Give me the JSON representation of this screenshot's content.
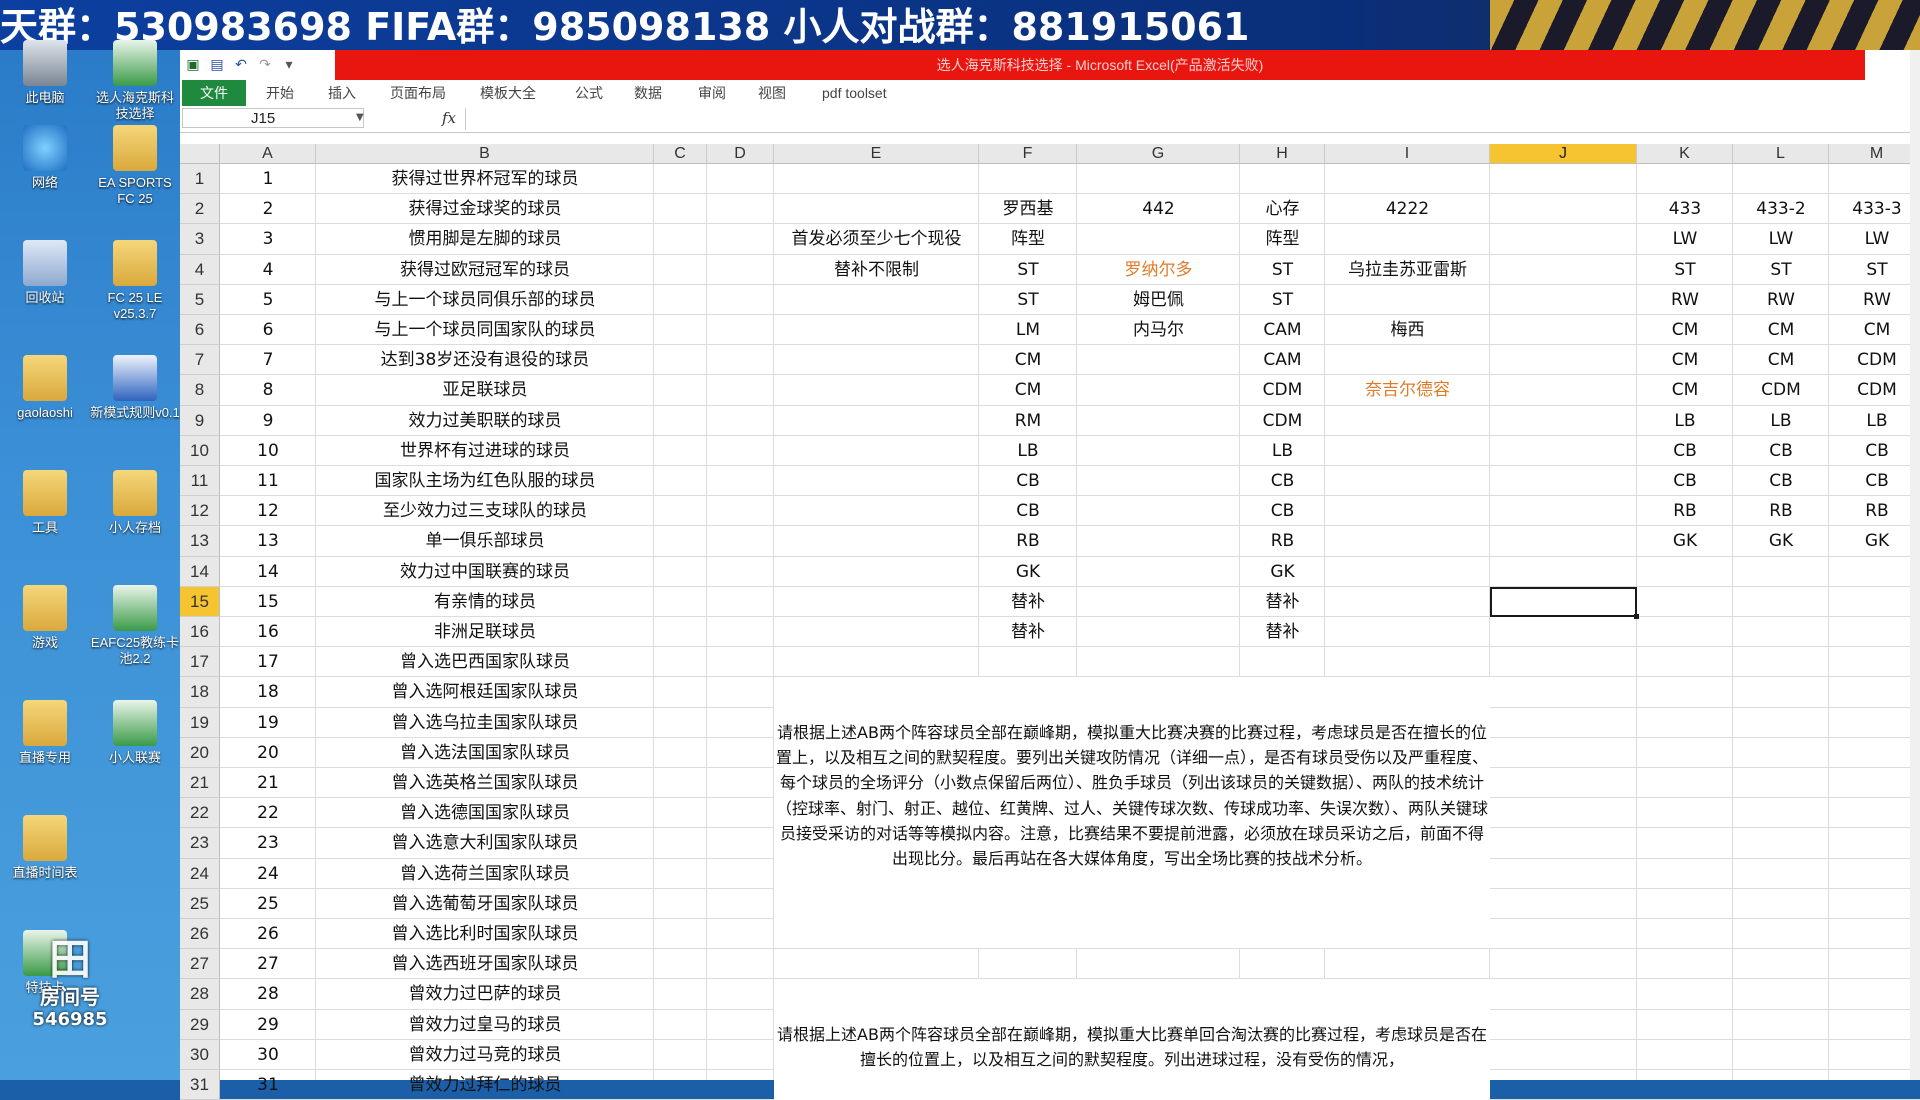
{
  "banner": {
    "text": "天群：530983698  FIFA群：985098138  小人对战群：881915061"
  },
  "desktop": {
    "icons": [
      {
        "label": "此电脑",
        "kind": "pc"
      },
      {
        "label": "选人海克斯科技选择",
        "kind": "xls"
      },
      {
        "label": "网络",
        "kind": "net"
      },
      {
        "label": "EA SPORTS FC 25",
        "kind": "folder"
      },
      {
        "label": "回收站",
        "kind": "bin"
      },
      {
        "label": "FC 25 LE v25.3.7",
        "kind": "folder"
      },
      {
        "label": "gaolaoshi",
        "kind": "folder"
      },
      {
        "label": "新模式规则v0.1",
        "kind": "doc"
      },
      {
        "label": "工具",
        "kind": "folder"
      },
      {
        "label": "小人存档",
        "kind": "folder"
      },
      {
        "label": "游戏",
        "kind": "folder"
      },
      {
        "label": "EAFC25教练卡池2.2",
        "kind": "xls"
      },
      {
        "label": "直播专用",
        "kind": "folder"
      },
      {
        "label": "小人联赛",
        "kind": "xls"
      },
      {
        "label": "直播时间表",
        "kind": "folder"
      },
      {
        "label": "特技卡",
        "kind": "xls"
      }
    ],
    "watermark": {
      "label": "房间号",
      "number": "546985"
    }
  },
  "excel": {
    "window_title": "选人海克斯科技选择 - Microsoft Excel(产品激活失败)",
    "tabs": [
      "文件",
      "开始",
      "插入",
      "页面布局",
      "模板大全",
      "公式",
      "数据",
      "审阅",
      "视图",
      "pdf toolset"
    ],
    "name_box": "J15",
    "formula": "",
    "columns": [
      "A",
      "B",
      "C",
      "D",
      "E",
      "F",
      "G",
      "H",
      "I",
      "J",
      "K",
      "L",
      "M"
    ],
    "selected_column": "J",
    "selected_row": 15,
    "rows": [
      {
        "n": 1,
        "A": "1",
        "B": "获得过世界杯冠军的球员"
      },
      {
        "n": 2,
        "A": "2",
        "B": "获得过金球奖的球员",
        "F": "罗西基",
        "G": "442",
        "H": "心存",
        "I": "4222",
        "K": "433",
        "L": "433-2",
        "M": "433-3"
      },
      {
        "n": 3,
        "A": "3",
        "B": "惯用脚是左脚的球员",
        "E": "首发必须至少七个现役",
        "F": "阵型",
        "H": "阵型",
        "K": "LW",
        "L": "LW",
        "M": "LW"
      },
      {
        "n": 4,
        "A": "4",
        "B": "获得过欧冠冠军的球员",
        "E": "替补不限制",
        "F": "ST",
        "G": "罗纳尔多",
        "H": "ST",
        "I": "乌拉圭苏亚雷斯",
        "K": "ST",
        "L": "ST",
        "M": "ST"
      },
      {
        "n": 5,
        "A": "5",
        "B": "与上一个球员同俱乐部的球员",
        "F": "ST",
        "G": "姆巴佩",
        "H": "ST",
        "K": "RW",
        "L": "RW",
        "M": "RW"
      },
      {
        "n": 6,
        "A": "6",
        "B": "与上一个球员同国家队的球员",
        "F": "LM",
        "G": "内马尔",
        "H": "CAM",
        "I": "梅西",
        "K": "CM",
        "L": "CM",
        "M": "CM"
      },
      {
        "n": 7,
        "A": "7",
        "B": "达到38岁还没有退役的球员",
        "F": "CM",
        "H": "CAM",
        "K": "CM",
        "L": "CM",
        "M": "CDM"
      },
      {
        "n": 8,
        "A": "8",
        "B": "亚足联球员",
        "F": "CM",
        "H": "CDM",
        "I": "奈吉尔德容",
        "K": "CM",
        "L": "CDM",
        "M": "CDM"
      },
      {
        "n": 9,
        "A": "9",
        "B": "效力过美职联的球员",
        "F": "RM",
        "H": "CDM",
        "K": "LB",
        "L": "LB",
        "M": "LB"
      },
      {
        "n": 10,
        "A": "10",
        "B": "世界杯有过进球的球员",
        "F": "LB",
        "H": "LB",
        "K": "CB",
        "L": "CB",
        "M": "CB"
      },
      {
        "n": 11,
        "A": "11",
        "B": "国家队主场为红色队服的球员",
        "F": "CB",
        "H": "CB",
        "K": "CB",
        "L": "CB",
        "M": "CB"
      },
      {
        "n": 12,
        "A": "12",
        "B": "至少效力过三支球队的球员",
        "F": "CB",
        "H": "CB",
        "K": "RB",
        "L": "RB",
        "M": "RB"
      },
      {
        "n": 13,
        "A": "13",
        "B": "单一俱乐部球员",
        "F": "RB",
        "H": "RB",
        "K": "GK",
        "L": "GK",
        "M": "GK"
      },
      {
        "n": 14,
        "A": "14",
        "B": "效力过中国联赛的球员",
        "F": "GK",
        "H": "GK"
      },
      {
        "n": 15,
        "A": "15",
        "B": "有亲情的球员",
        "F": "替补",
        "H": "替补"
      },
      {
        "n": 16,
        "A": "16",
        "B": "非洲足联球员",
        "F": "替补",
        "H": "替补"
      },
      {
        "n": 17,
        "A": "17",
        "B": "曾入选巴西国家队球员"
      },
      {
        "n": 18,
        "A": "18",
        "B": "曾入选阿根廷国家队球员"
      },
      {
        "n": 19,
        "A": "19",
        "B": "曾入选乌拉圭国家队球员"
      },
      {
        "n": 20,
        "A": "20",
        "B": "曾入选法国国家队球员"
      },
      {
        "n": 21,
        "A": "21",
        "B": "曾入选英格兰国家队球员"
      },
      {
        "n": 22,
        "A": "22",
        "B": "曾入选德国国家队球员"
      },
      {
        "n": 23,
        "A": "23",
        "B": "曾入选意大利国家队球员"
      },
      {
        "n": 24,
        "A": "24",
        "B": "曾入选荷兰国家队球员"
      },
      {
        "n": 25,
        "A": "25",
        "B": "曾入选葡萄牙国家队球员"
      },
      {
        "n": 26,
        "A": "26",
        "B": "曾入选比利时国家队球员"
      },
      {
        "n": 27,
        "A": "27",
        "B": "曾入选西班牙国家队球员"
      },
      {
        "n": 28,
        "A": "28",
        "B": "曾效力过巴萨的球员"
      },
      {
        "n": 29,
        "A": "29",
        "B": "曾效力过皇马的球员"
      },
      {
        "n": 30,
        "A": "30",
        "B": "曾效力过马竞的球员"
      },
      {
        "n": 31,
        "A": "31",
        "B": "曾效力过拜仁的球员"
      }
    ],
    "orange_cells": [
      "G4",
      "I8"
    ],
    "paragraph1": "请根据上述AB两个阵容球员全部在巅峰期，模拟重大比赛决赛的比赛过程，考虑球员是否在擅长的位置上，以及相互之间的默契程度。要列出关键攻防情况（详细一点），是否有球员受伤以及严重程度、每个球员的全场评分（小数点保留后两位）、胜负手球员（列出该球员的关键数据）、两队的技术统计（控球率、射门、射正、越位、红黄牌、过人、关键传球次数、传球成功率、失误次数）、两队关键球员接受采访的对话等等模拟内容。注意，比赛结果不要提前泄露，必须放在球员采访之后，前面不得出现比分。最后再站在各大媒体角度，写出全场比赛的技战术分析。",
    "paragraph2": "请根据上述AB两个阵容球员全部在巅峰期，模拟重大比赛单回合淘汰赛的比赛过程，考虑球员是否在擅长的位置上，以及相互之间的默契程度。列出进球过程，没有受伤的情况，"
  }
}
